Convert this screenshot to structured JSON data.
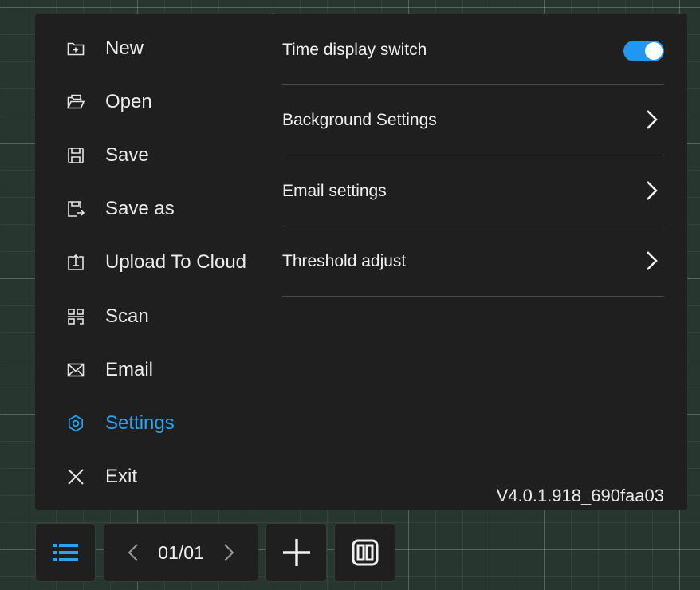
{
  "menu": {
    "items": [
      {
        "label": "New",
        "icon": "new-file-icon"
      },
      {
        "label": "Open",
        "icon": "open-folder-icon"
      },
      {
        "label": "Save",
        "icon": "save-icon"
      },
      {
        "label": "Save as",
        "icon": "save-as-icon"
      },
      {
        "label": "Upload To Cloud",
        "icon": "upload-cloud-icon"
      },
      {
        "label": "Scan",
        "icon": "scan-qr-icon"
      },
      {
        "label": "Email",
        "icon": "email-icon"
      },
      {
        "label": "Settings",
        "icon": "gear-icon",
        "active": true
      },
      {
        "label": "Exit",
        "icon": "close-icon"
      }
    ]
  },
  "settings": {
    "time_display": {
      "label": "Time display switch",
      "enabled": true
    },
    "background": {
      "label": "Background Settings"
    },
    "email": {
      "label": "Email settings"
    },
    "threshold": {
      "label": "Threshold adjust"
    }
  },
  "version": "V4.0.1.918_690faa03",
  "toolbar": {
    "page_indicator": "01/01",
    "icons": [
      "menu-list-icon",
      "chevron-left-icon",
      "chevron-right-icon",
      "plus-icon",
      "split-view-icon"
    ]
  },
  "colors": {
    "accent": "#2aa4f0",
    "toggle_on": "#2196f3",
    "panel": "#1f1f1f",
    "background": "#283630"
  }
}
